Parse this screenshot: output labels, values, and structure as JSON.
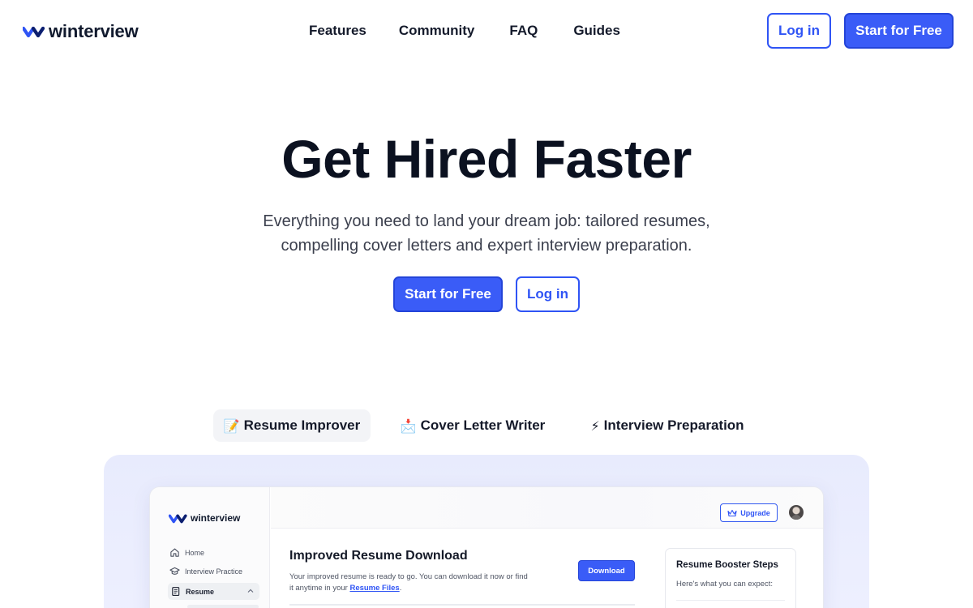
{
  "brand": {
    "name": "winterview",
    "accent_color": "#3a5cf7",
    "logo_icon": "winterview-wave-logo"
  },
  "nav": {
    "links": [
      "Features",
      "Community",
      "FAQ",
      "Guides"
    ],
    "login_label": "Log in",
    "start_label": "Start for Free"
  },
  "hero": {
    "title": "Get Hired Faster",
    "subtitle_line1": "Everything you need to land your dream job: tailored resumes,",
    "subtitle_line2": "compelling cover letters and expert interview preparation.",
    "start_label": "Start for Free",
    "login_label": "Log in"
  },
  "tabs": [
    {
      "emoji": "📝",
      "label": "Resume Improver",
      "active": true
    },
    {
      "emoji": "📩",
      "label": "Cover Letter Writer",
      "active": false
    },
    {
      "emoji": "⚡",
      "label": "Interview Preparation",
      "active": false
    }
  ],
  "preview": {
    "sidebar": {
      "logo_text": "winterview",
      "items": [
        {
          "label": "Home",
          "icon": "home-icon"
        },
        {
          "label": "Interview Practice",
          "icon": "graduation-cap-icon"
        },
        {
          "label": "Resume",
          "icon": "document-icon",
          "expanded": true
        }
      ]
    },
    "topbar": {
      "upgrade_label": "Upgrade",
      "upgrade_icon": "crown-icon"
    },
    "content": {
      "title": "Improved Resume Download",
      "text_before_link": "Your improved resume is ready to go. You can download it now or find it anytime in your ",
      "link_text": "Resume Files",
      "text_after_link": ".",
      "download_label": "Download"
    },
    "booster": {
      "title": "Resume Booster Steps",
      "text": "Here's what you can expect:"
    }
  }
}
